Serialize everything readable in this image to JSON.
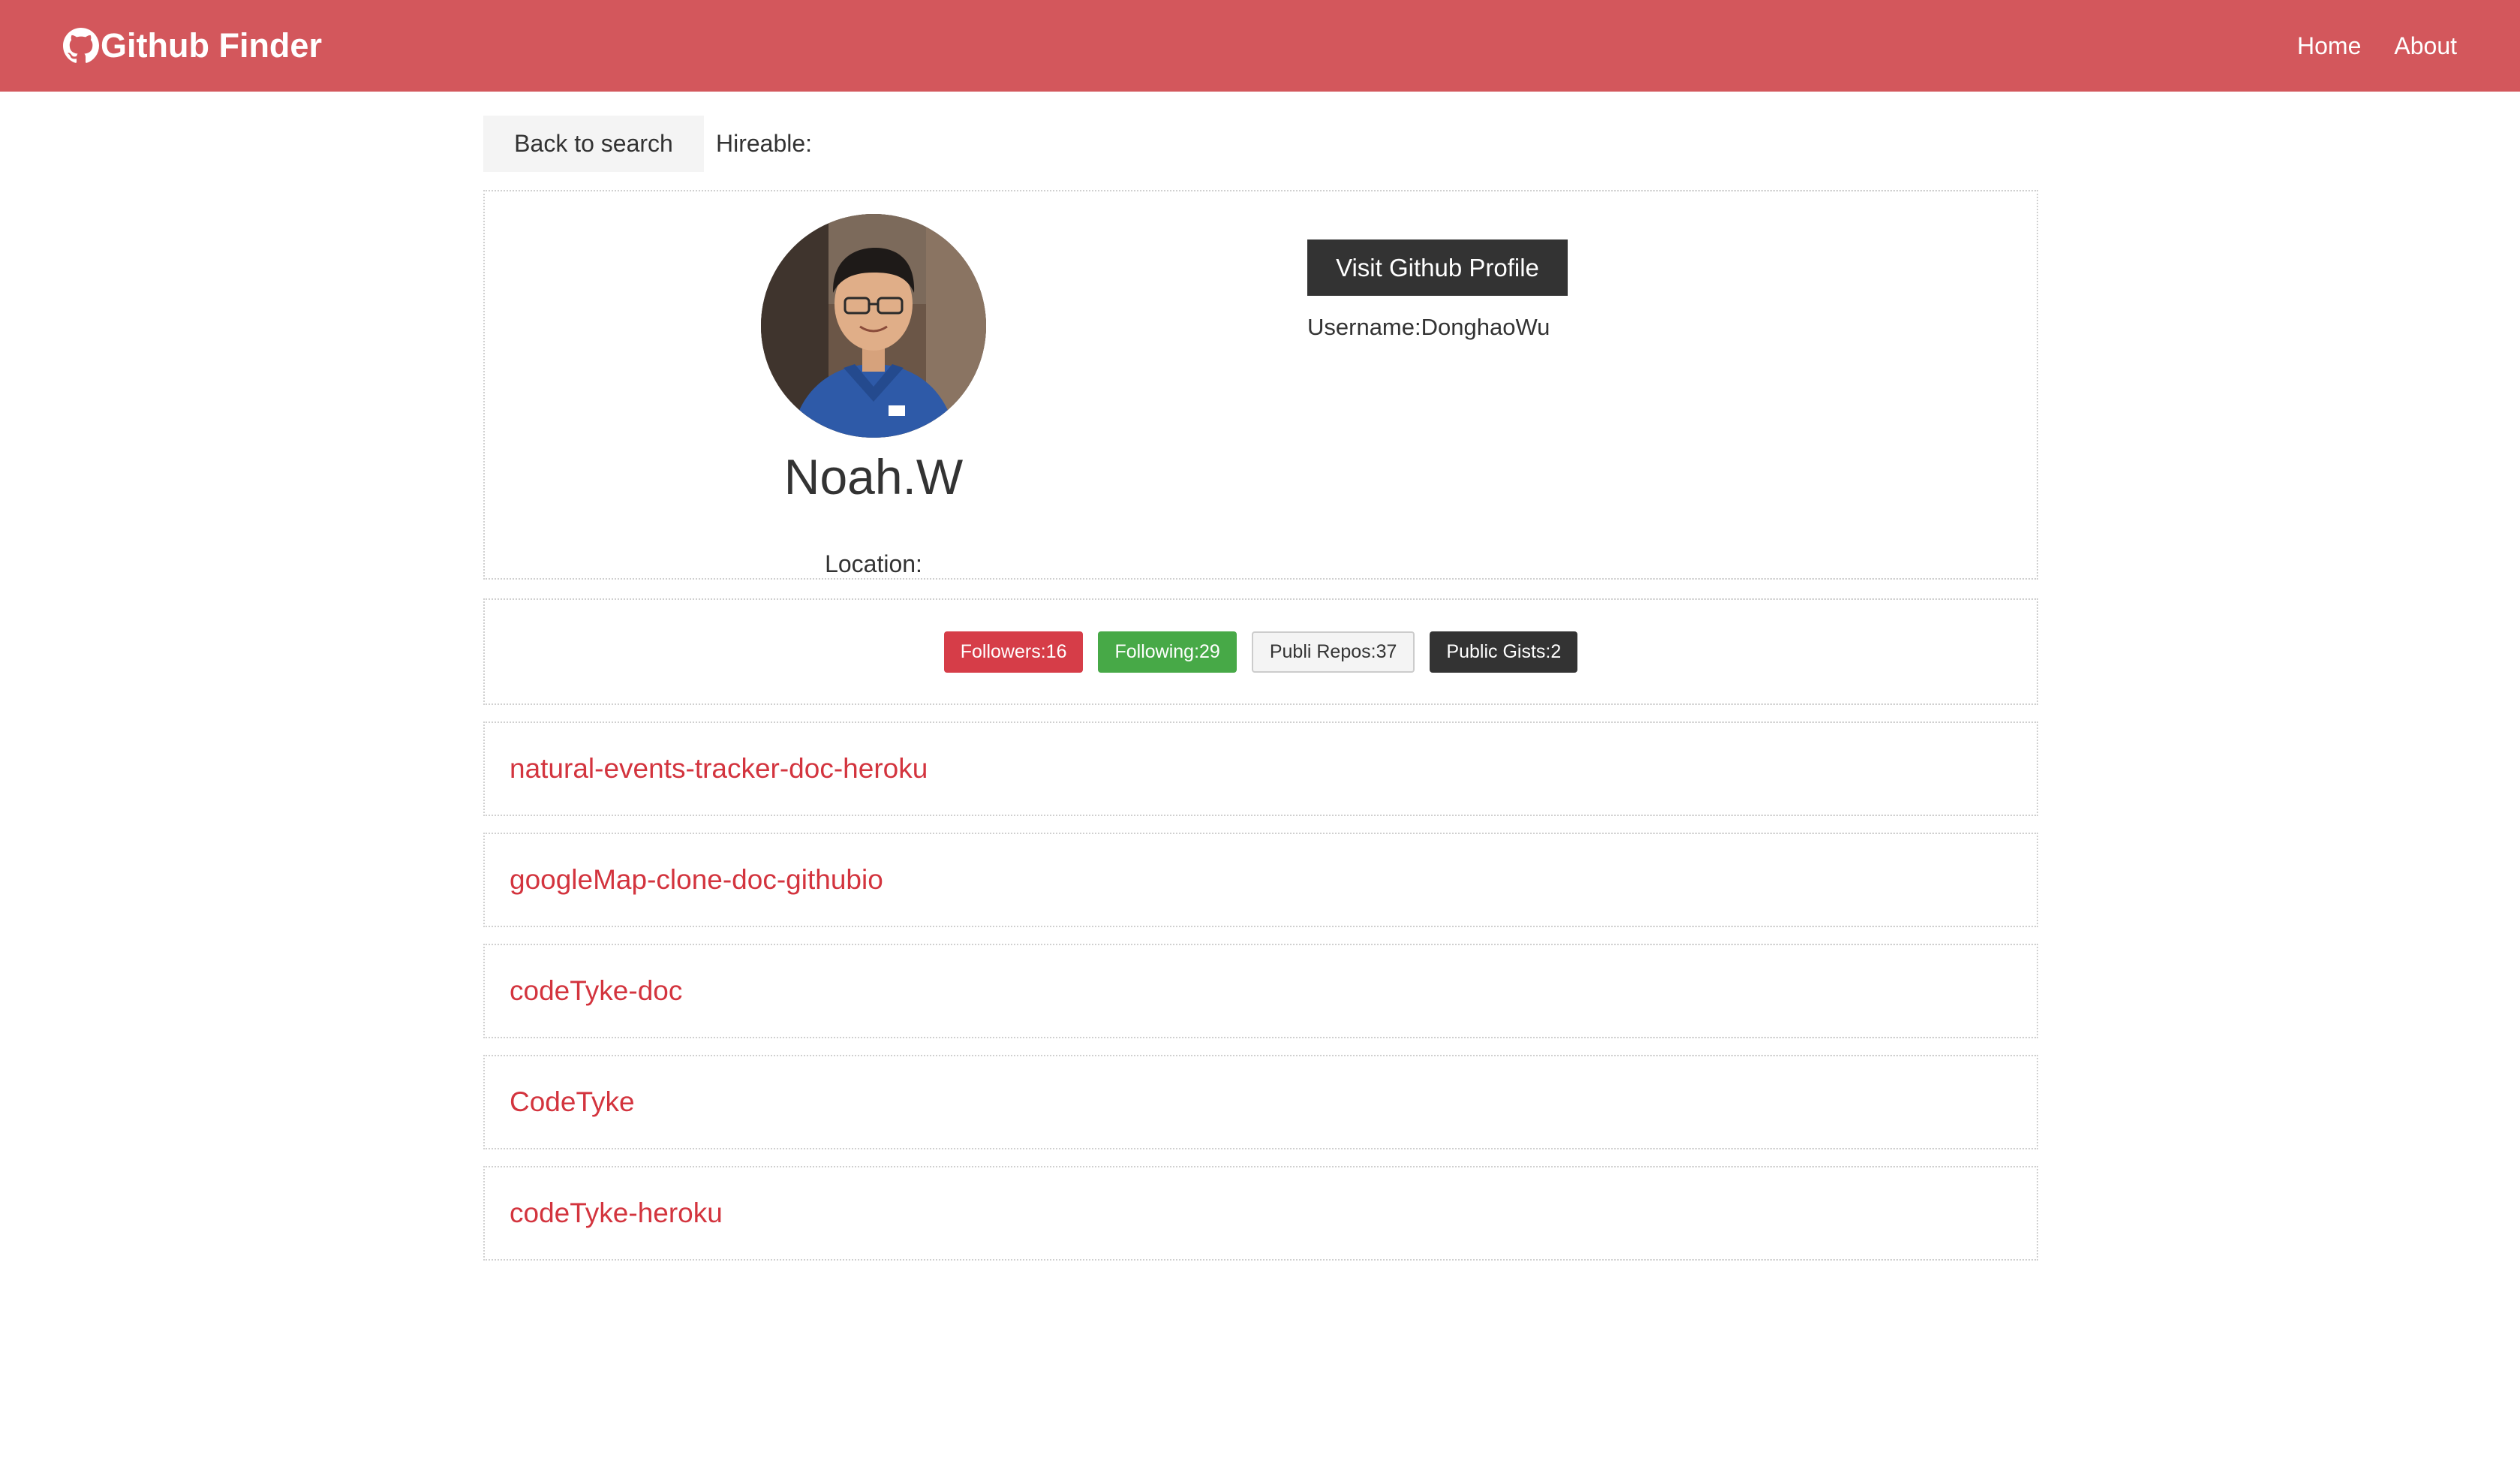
{
  "navbar": {
    "brand": "Github Finder",
    "links": [
      "Home",
      "About"
    ],
    "color": "#d3575c"
  },
  "toolbar": {
    "back_label": "Back to search",
    "hireable_label": "Hireable:"
  },
  "profile": {
    "name": "Noah.W",
    "location_label": "Location:",
    "visit_label": "Visit Github Profile",
    "username_label": "Username:DonghaoWu"
  },
  "stats": {
    "followers": "Followers:16",
    "following": "Following:29",
    "repos": "Publi Repos:37",
    "gists": "Public Gists:2"
  },
  "repos": [
    "natural-events-tracker-doc-heroku",
    "googleMap-clone-doc-githubio",
    "codeTyke-doc",
    "CodeTyke",
    "codeTyke-heroku"
  ]
}
